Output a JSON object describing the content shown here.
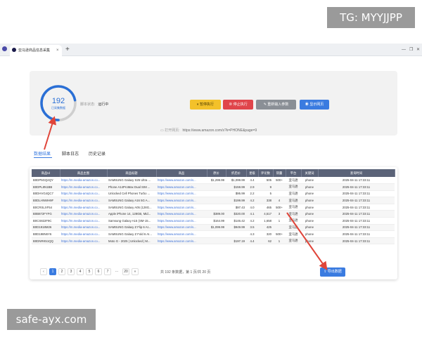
{
  "watermark_top": "TG: MYYJJPP",
  "watermark_bottom": "safe-ayx.com",
  "browser": {
    "tab_title": "亚马逊商品信息采集",
    "tab_close": "×",
    "new_tab": "+",
    "win_min": "—",
    "win_restore": "❐",
    "win_close": "✕"
  },
  "status": {
    "count": "192",
    "count_label": "已采集数据",
    "script_status_label": "脚本状态:",
    "script_status_value": "运行中",
    "progress_ratio": 0.72
  },
  "buttons": {
    "pause": "暂停执行",
    "stop": "停止执行",
    "reinput": "重新输入参数",
    "show": "显示网页",
    "export": "导出数据"
  },
  "open_url": {
    "label": "打开网页:",
    "value": "https://www.amazon.com/s?k=PHONE&page=9"
  },
  "tabs": [
    "数据结果",
    "脚本日志",
    "历史记录"
  ],
  "table": {
    "headers": [
      "商品Id",
      "商品主图",
      "商品标题",
      "商品",
      "原价",
      "折后价",
      "星级",
      "评论数",
      "销量",
      "平台",
      "关键词",
      "查询时间"
    ],
    "rows": [
      [
        "B0DP5GQ4QY",
        "https://m.media-amazon.co...",
        "SAMSUNG Galaxy S25 Ultra ...",
        "https://www.amazon.com/s...",
        "$1,299.99",
        "$1,099.99",
        "4.4",
        "505",
        "500+",
        "亚马逊",
        "phone",
        "2025-04-11 17:33:11"
      ],
      [
        "B0DPL8N1BB",
        "https://m.media-amazon.co...",
        "Phone A14ProMax Dual SIM ...",
        "https://www.amazon.com/s...",
        "",
        "$159.99",
        "2.9",
        "9",
        "",
        "亚马逊",
        "phone",
        "2025-04-11 17:33:11"
      ],
      [
        "B0DHVG4QC7",
        "https://m.media-amazon.co...",
        "Unlocked Cell Phones Turbo ...",
        "https://www.amazon.com/s...",
        "",
        "$95.99",
        "2.2",
        "5",
        "",
        "亚马逊",
        "phone",
        "2025-04-11 17:33:11"
      ],
      [
        "B0DLHNWH9F",
        "https://m.media-amazon.co...",
        "SAMSUNG Galaxy A16 5G A...",
        "https://www.amazon.com/s...",
        "",
        "$199.99",
        "4.2",
        "338",
        "4",
        "亚马逊",
        "phone",
        "2025-04-11 17:33:11"
      ],
      [
        "B0CRSLXF54",
        "https://m.media-amazon.co...",
        "SAMSUNG Galaxy A05 (128G...",
        "https://www.amazon.com/s...",
        "",
        "$97.43",
        "4.0",
        "465",
        "500+",
        "亚马逊",
        "phone",
        "2025-04-11 17:33:11"
      ],
      [
        "B0B872FYFG",
        "https://m.media-amazon.co...",
        "Apple iPhone 14, 128GB, Mid...",
        "https://www.amazon.com/s...",
        "$389.00",
        "$320.00",
        "4.1",
        "4,517",
        "3",
        "亚马逊",
        "phone",
        "2025-04-11 17:33:11"
      ],
      [
        "B0CS822F9C",
        "https://m.media-amazon.co...",
        "Samsung Galaxy A15 (SM-15...",
        "https://www.amazon.com/s...",
        "$164.99",
        "$146.42",
        "4.2",
        "1,658",
        "1",
        "亚马逊",
        "phone",
        "2025-04-11 17:33:11"
      ],
      [
        "B0D1918M26",
        "https://m.media-amazon.co...",
        "SAMSUNG Galaxy Z Flip 6 AI...",
        "https://www.amazon.com/s...",
        "$1,099.99",
        "$949.99",
        "3.5",
        "425",
        "",
        "亚马逊",
        "phone",
        "2025-04-11 17:33:11"
      ],
      [
        "B0D198N6Y6",
        "https://m.media-amazon.co...",
        "SAMSUNG Galaxy Z Fold 6 AI...",
        "https://www.amazon.com/s...",
        "",
        "",
        "4.3",
        "320",
        "500+",
        "亚马逊",
        "phone",
        "2025-04-11 17:33:11"
      ],
      [
        "B0DNRK51QQ",
        "https://m.media-amazon.co...",
        "Moto G - 2025 | Unlocked | M...",
        "https://www.amazon.com/s...",
        "",
        "$197.19",
        "4.4",
        "62",
        "1",
        "亚马逊",
        "phone",
        "2025-04-11 17:33:11"
      ]
    ]
  },
  "pager": {
    "prev": "‹",
    "pages": [
      "1",
      "2",
      "3",
      "4",
      "5",
      "6",
      "7",
      "...",
      "20"
    ],
    "next": "»",
    "info": "共 192 条数据，第 1 页/共 20 页"
  },
  "colors": {
    "accent": "#3a7be0",
    "annotation_arrow": "#e0453a"
  }
}
